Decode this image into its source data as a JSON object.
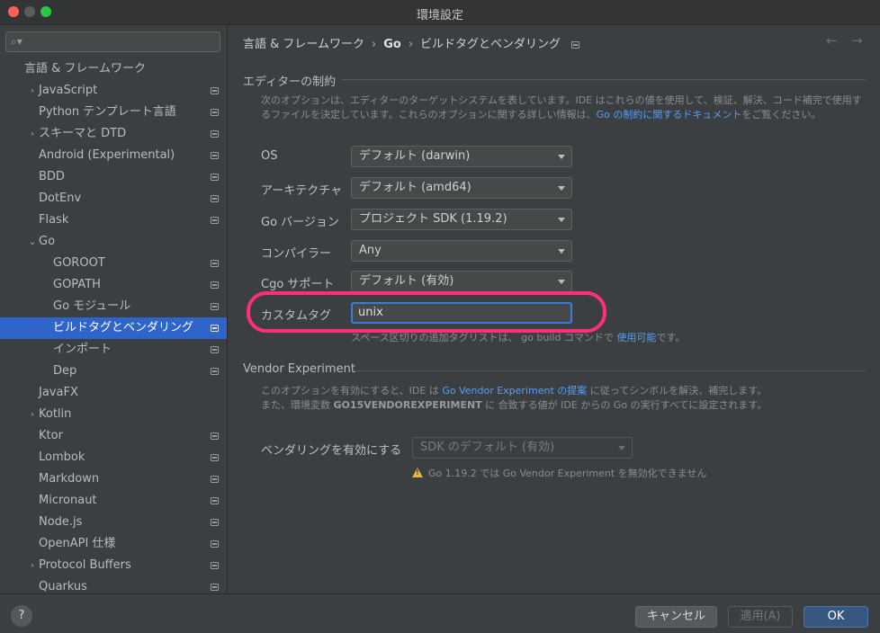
{
  "window": {
    "title": "環境設定"
  },
  "sidebar": {
    "search_placeholder": "",
    "items": [
      {
        "label": "言語 & フレームワーク",
        "indent": 0,
        "chevron": "",
        "page_icon": false,
        "selected": false
      },
      {
        "label": "JavaScript",
        "indent": 1,
        "chevron": "right",
        "page_icon": true,
        "selected": false
      },
      {
        "label": "Python テンプレート言語",
        "indent": 1,
        "chevron": "",
        "page_icon": true,
        "selected": false
      },
      {
        "label": "スキーマと DTD",
        "indent": 1,
        "chevron": "right",
        "page_icon": true,
        "selected": false
      },
      {
        "label": "Android (Experimental)",
        "indent": 1,
        "chevron": "",
        "page_icon": true,
        "selected": false
      },
      {
        "label": "BDD",
        "indent": 1,
        "chevron": "",
        "page_icon": true,
        "selected": false
      },
      {
        "label": "DotEnv",
        "indent": 1,
        "chevron": "",
        "page_icon": true,
        "selected": false
      },
      {
        "label": "Flask",
        "indent": 1,
        "chevron": "",
        "page_icon": true,
        "selected": false
      },
      {
        "label": "Go",
        "indent": 1,
        "chevron": "down",
        "page_icon": false,
        "selected": false
      },
      {
        "label": "GOROOT",
        "indent": 2,
        "chevron": "",
        "page_icon": true,
        "selected": false
      },
      {
        "label": "GOPATH",
        "indent": 2,
        "chevron": "",
        "page_icon": true,
        "selected": false
      },
      {
        "label": "Go モジュール",
        "indent": 2,
        "chevron": "",
        "page_icon": true,
        "selected": false
      },
      {
        "label": "ビルドタグとベンダリング",
        "indent": 2,
        "chevron": "",
        "page_icon": true,
        "selected": true
      },
      {
        "label": "インポート",
        "indent": 2,
        "chevron": "",
        "page_icon": true,
        "selected": false
      },
      {
        "label": "Dep",
        "indent": 2,
        "chevron": "",
        "page_icon": true,
        "selected": false
      },
      {
        "label": "JavaFX",
        "indent": 1,
        "chevron": "",
        "page_icon": false,
        "selected": false
      },
      {
        "label": "Kotlin",
        "indent": 1,
        "chevron": "right",
        "page_icon": false,
        "selected": false
      },
      {
        "label": "Ktor",
        "indent": 1,
        "chevron": "",
        "page_icon": true,
        "selected": false
      },
      {
        "label": "Lombok",
        "indent": 1,
        "chevron": "",
        "page_icon": true,
        "selected": false
      },
      {
        "label": "Markdown",
        "indent": 1,
        "chevron": "",
        "page_icon": true,
        "selected": false
      },
      {
        "label": "Micronaut",
        "indent": 1,
        "chevron": "",
        "page_icon": true,
        "selected": false
      },
      {
        "label": "Node.js",
        "indent": 1,
        "chevron": "",
        "page_icon": true,
        "selected": false
      },
      {
        "label": "OpenAPI 仕様",
        "indent": 1,
        "chevron": "",
        "page_icon": true,
        "selected": false
      },
      {
        "label": "Protocol Buffers",
        "indent": 1,
        "chevron": "right",
        "page_icon": true,
        "selected": false
      },
      {
        "label": "Quarkus",
        "indent": 1,
        "chevron": "",
        "page_icon": true,
        "selected": false
      }
    ]
  },
  "breadcrumb": {
    "part1": "言語 & フレームワーク",
    "sep": "›",
    "part2": "Go",
    "part3": "ビルドタグとベンダリング"
  },
  "nav": {
    "back": "←",
    "forward": "→"
  },
  "editor_constraints": {
    "title": "エディターの制約",
    "desc_line1": "次のオプションは、エディターのターゲットシステムを表しています。IDE はこれらの値を使用して、検証、解決、コード補完で使用す",
    "desc_line2_before": "るファイルを決定しています。これらのオプションに関する詳しい情報は、",
    "desc_link": "Go の制約に関するドキュメント",
    "desc_line2_after": "をご覧ください。",
    "fields": {
      "os": {
        "label": "OS",
        "value": "デフォルト (darwin)"
      },
      "arch": {
        "label": "アーキテクチャ",
        "value": "デフォルト (amd64)"
      },
      "go_version": {
        "label": "Go バージョン",
        "value": "プロジェクト SDK (1.19.2)"
      },
      "compiler": {
        "label": "コンパイラー",
        "value": "Any"
      },
      "cgo": {
        "label": "Cgo サポート",
        "value": "デフォルト (有効)"
      },
      "custom_tags": {
        "label": "カスタムタグ",
        "value": "unix"
      }
    },
    "hint_before": "スペース区切りの追加タグリストは、 go build コマンドで ",
    "hint_link": "使用可能",
    "hint_after": "です。"
  },
  "vendor": {
    "title": "Vendor Experiment",
    "desc_line1_before": "このオプションを有効にすると、IDE は ",
    "desc_link": "Go Vendor Experiment の提案",
    "desc_line1_after": " に従ってシンボルを解決、補完します。",
    "desc_line2_before": "また、環境変数 ",
    "desc_env": "GO15VENDOREXPERIMENT",
    "desc_line2_after": " に 合致する値が IDE からの Go の実行すべてに設定されます。",
    "enable_label": "ベンダリングを有効にする",
    "enable_value": "SDK のデフォルト (有効)",
    "warning": "Go 1.19.2 では Go Vendor Experiment を無効化できません"
  },
  "buttons": {
    "help": "?",
    "cancel": "キャンセル",
    "apply": "適用(A)",
    "ok": "OK"
  }
}
